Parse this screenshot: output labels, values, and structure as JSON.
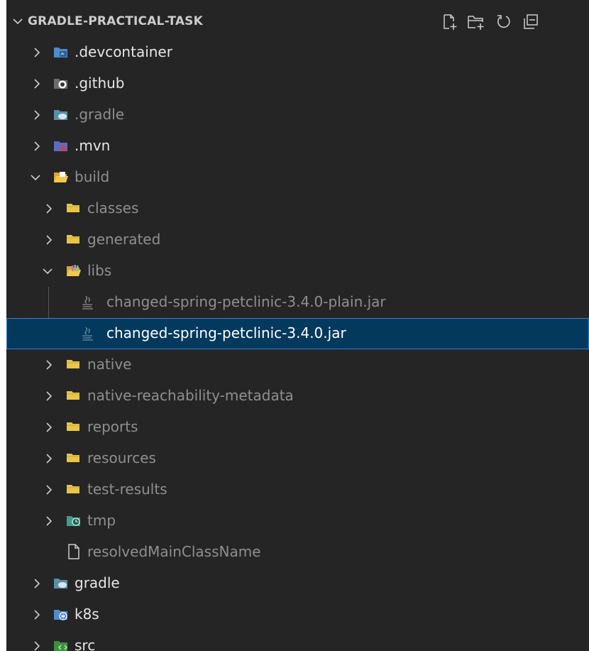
{
  "explorer": {
    "section_title": "GRADLE-PRACTICAL-TASK",
    "actions": [
      {
        "name": "new-file-button",
        "icon": "new-file-icon"
      },
      {
        "name": "new-folder-button",
        "icon": "new-folder-icon"
      },
      {
        "name": "refresh-button",
        "icon": "refresh-icon"
      },
      {
        "name": "collapse-all-button",
        "icon": "collapse-all-icon"
      }
    ],
    "items": [
      {
        "label": ".devcontainer",
        "icon": "devcontainer-folder-icon",
        "expanded": false,
        "depth": 0,
        "type": "folder"
      },
      {
        "label": ".github",
        "icon": "github-folder-icon",
        "expanded": false,
        "depth": 0,
        "type": "folder"
      },
      {
        "label": ".gradle",
        "icon": "gradle-folder-icon",
        "expanded": false,
        "depth": 0,
        "type": "folder",
        "dimmed": true
      },
      {
        "label": ".mvn",
        "icon": "mvn-folder-icon",
        "expanded": false,
        "depth": 0,
        "type": "folder"
      },
      {
        "label": "build",
        "icon": "build-folder-open-icon",
        "expanded": true,
        "depth": 0,
        "type": "folder",
        "dimmed": true
      },
      {
        "label": "classes",
        "icon": "folder-icon",
        "expanded": false,
        "depth": 1,
        "type": "folder",
        "dimmed": true
      },
      {
        "label": "generated",
        "icon": "folder-icon",
        "expanded": false,
        "depth": 1,
        "type": "folder",
        "dimmed": true
      },
      {
        "label": "libs",
        "icon": "libs-folder-open-icon",
        "expanded": true,
        "depth": 1,
        "type": "folder",
        "dimmed": true
      },
      {
        "label": "changed-spring-petclinic-3.4.0-plain.jar",
        "icon": "java-jar-icon",
        "depth": 2,
        "type": "file",
        "dimmed": true
      },
      {
        "label": "changed-spring-petclinic-3.4.0.jar",
        "icon": "java-jar-icon",
        "depth": 2,
        "type": "file",
        "selected": true
      },
      {
        "label": "native",
        "icon": "folder-icon",
        "expanded": false,
        "depth": 1,
        "type": "folder",
        "dimmed": true
      },
      {
        "label": "native-reachability-metadata",
        "icon": "folder-icon",
        "expanded": false,
        "depth": 1,
        "type": "folder",
        "dimmed": true
      },
      {
        "label": "reports",
        "icon": "folder-icon",
        "expanded": false,
        "depth": 1,
        "type": "folder",
        "dimmed": true
      },
      {
        "label": "resources",
        "icon": "folder-icon",
        "expanded": false,
        "depth": 1,
        "type": "folder",
        "dimmed": true
      },
      {
        "label": "test-results",
        "icon": "folder-icon",
        "expanded": false,
        "depth": 1,
        "type": "folder",
        "dimmed": true
      },
      {
        "label": "tmp",
        "icon": "tmp-folder-icon",
        "expanded": false,
        "depth": 1,
        "type": "folder",
        "dimmed": true
      },
      {
        "label": "resolvedMainClassName",
        "icon": "file-icon",
        "depth": 1,
        "type": "file",
        "dimmed": true
      },
      {
        "label": "gradle",
        "icon": "gradle-folder-icon",
        "expanded": false,
        "depth": 0,
        "type": "folder"
      },
      {
        "label": "k8s",
        "icon": "k8s-folder-icon",
        "expanded": false,
        "depth": 0,
        "type": "folder"
      },
      {
        "label": "src",
        "icon": "src-folder-icon",
        "expanded": false,
        "depth": 0,
        "type": "folder"
      }
    ]
  },
  "colors": {
    "background": "#252526",
    "selection": "#04395e",
    "selection_border": "#2f7fd0",
    "folder": "#e8c547",
    "dim_text": "#8f8f8f"
  }
}
